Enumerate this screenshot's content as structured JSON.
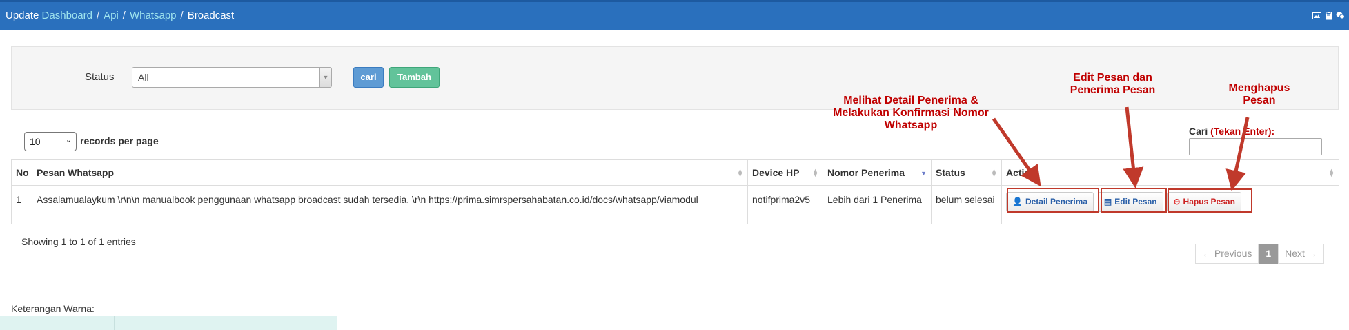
{
  "header": {
    "breadcrumb_lead": "Update",
    "crumbs": [
      "Dashboard",
      "Api",
      "Whatsapp"
    ],
    "current": "Broadcast",
    "icons": [
      "image-icon",
      "clipboard-icon",
      "chat-icon"
    ]
  },
  "filter": {
    "status_label": "Status",
    "status_value": "All",
    "cari_label": "cari",
    "tambah_label": "Tambah"
  },
  "table_controls": {
    "length_value": "10",
    "length_label": "records per page",
    "search_label": "Cari",
    "search_hint": "(Tekan Enter):",
    "search_value": ""
  },
  "table": {
    "columns": [
      "No",
      "Pesan Whatsapp",
      "Device HP",
      "Nomor Penerima",
      "Status",
      "Action"
    ],
    "rows": [
      {
        "no": "1",
        "pesan": "Assalamualaykum \\r\\n\\n manualbook penggunaan whatsapp broadcast sudah tersedia. \\r\\n https://prima.simrspersahabatan.co.id/docs/whatsapp/viamodul",
        "device": "notifprima2v5",
        "penerima": "Lebih dari 1 Penerima",
        "status": "belum selesai",
        "actions": [
          "Detail Penerima",
          "Edit Pesan",
          "Hapus Pesan"
        ]
      }
    ]
  },
  "footer": {
    "showing": "Showing 1 to 1 of 1 entries",
    "prev": "← Previous",
    "page": "1",
    "next": "Next →",
    "legend_label": "Keterangan Warna:"
  },
  "annotations": {
    "detail": "Melihat Detail Penerima & Melakukan Konfirmasi Nomor Whatsapp",
    "edit": "Edit Pesan dan Penerima Pesan",
    "hapus": "Menghapus Pesan"
  },
  "colors": {
    "header_bg": "#2a70bd",
    "annotation": "#c00000",
    "cari_btn": "#5e9bd4",
    "tambah_btn": "#62c39a"
  }
}
